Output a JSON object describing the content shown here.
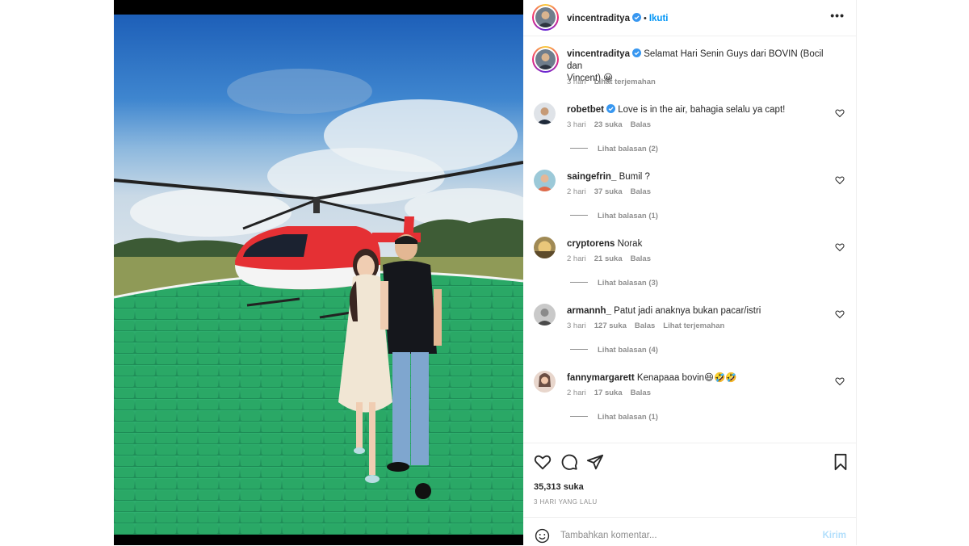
{
  "post": {
    "author": "vincentraditya",
    "follow_label": "Ikuti",
    "separator": "•",
    "caption_lines": [
      "Selamat Hari Senin Guys dari BOVIN (Bocil dan",
      "Vincent) 😀"
    ],
    "caption_time": "3 hari",
    "caption_translate": "Lihat terjemahan"
  },
  "comments": [
    {
      "user": "robetbet",
      "verified": true,
      "text": "Love is in the air, bahagia selalu ya capt!",
      "time": "3 hari",
      "likes": "23 suka",
      "reply": "Balas",
      "translate": "",
      "replies": "Lihat balasan (2)"
    },
    {
      "user": "saingefrin_",
      "verified": false,
      "text": "Bumil ?",
      "time": "2 hari",
      "likes": "37 suka",
      "reply": "Balas",
      "translate": "",
      "replies": "Lihat balasan (1)"
    },
    {
      "user": "cryptorens",
      "verified": false,
      "text": "Norak",
      "time": "2 hari",
      "likes": "21 suka",
      "reply": "Balas",
      "translate": "",
      "replies": "Lihat balasan (3)"
    },
    {
      "user": "armannh_",
      "verified": false,
      "text": "Patut jadi anaknya bukan pacar/istri",
      "time": "3 hari",
      "likes": "127 suka",
      "reply": "Balas",
      "translate": "Lihat terjemahan",
      "replies": "Lihat balasan (4)"
    },
    {
      "user": "fannymargarett",
      "verified": false,
      "text": "Kenapaaa bovin😆🤣🤣",
      "time": "2 hari",
      "likes": "17 suka",
      "reply": "Balas",
      "translate": "",
      "replies": "Lihat balasan (1)"
    }
  ],
  "footer": {
    "likes": "35,313 suka",
    "time_ago": "3 HARI YANG LALU",
    "comment_placeholder": "Tambahkan komentar...",
    "post_label": "Kirim"
  },
  "icons": [
    "verified-badge-icon",
    "more-options-icon",
    "heart-icon",
    "comment-icon",
    "share-icon",
    "bookmark-icon",
    "emoji-icon"
  ],
  "colors": {
    "link": "#0095f6",
    "verified": "#3897f0",
    "muted": "#8e8e8e",
    "post_disabled": "#b2dffc"
  }
}
